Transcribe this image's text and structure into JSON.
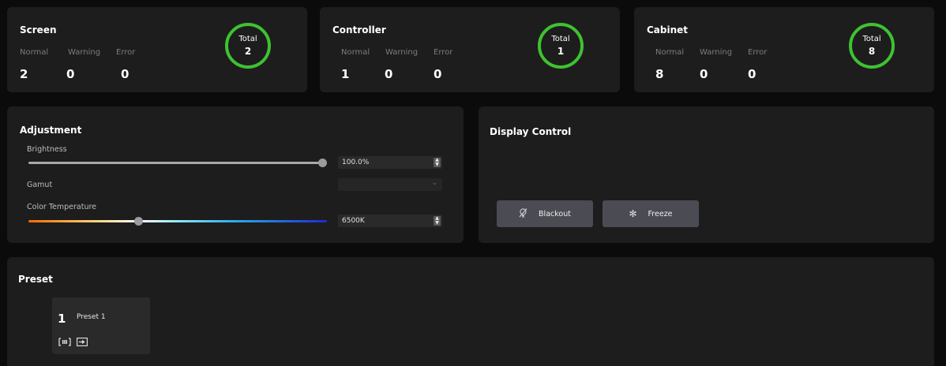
{
  "status_cards": [
    {
      "title": "Screen",
      "labels": [
        "Normal",
        "Warning",
        "Error"
      ],
      "values": [
        "2",
        "0",
        "0"
      ],
      "total_label": "Total",
      "total": "2"
    },
    {
      "title": "Controller",
      "labels": [
        "Normal",
        "Warning",
        "Error"
      ],
      "values": [
        "1",
        "0",
        "0"
      ],
      "total_label": "Total",
      "total": "1"
    },
    {
      "title": "Cabinet",
      "labels": [
        "Normal",
        "Warning",
        "Error"
      ],
      "values": [
        "8",
        "0",
        "0"
      ],
      "total_label": "Total",
      "total": "8"
    }
  ],
  "adjustment": {
    "title": "Adjustment",
    "brightness_label": "Brightness",
    "brightness_value": "100.0%",
    "brightness_level": 1.0,
    "gamut_label": "Gamut",
    "gamut_value": "",
    "color_temp_label": "Color Temperature",
    "color_temp_value": "6500K",
    "color_temp_level": 0.37
  },
  "display_control": {
    "title": "Display Control",
    "blackout_label": "Blackout",
    "blackout_icon": "bulb-off-icon",
    "freeze_label": "Freeze",
    "freeze_icon": "snowflake-icon"
  },
  "preset": {
    "title": "Preset",
    "items": [
      {
        "number": "1",
        "name": "Preset 1"
      }
    ]
  },
  "colors": {
    "ring": "#3ec231",
    "card": "#1d1d1d",
    "background": "#0b0b0b",
    "button": "#4b4b53"
  }
}
